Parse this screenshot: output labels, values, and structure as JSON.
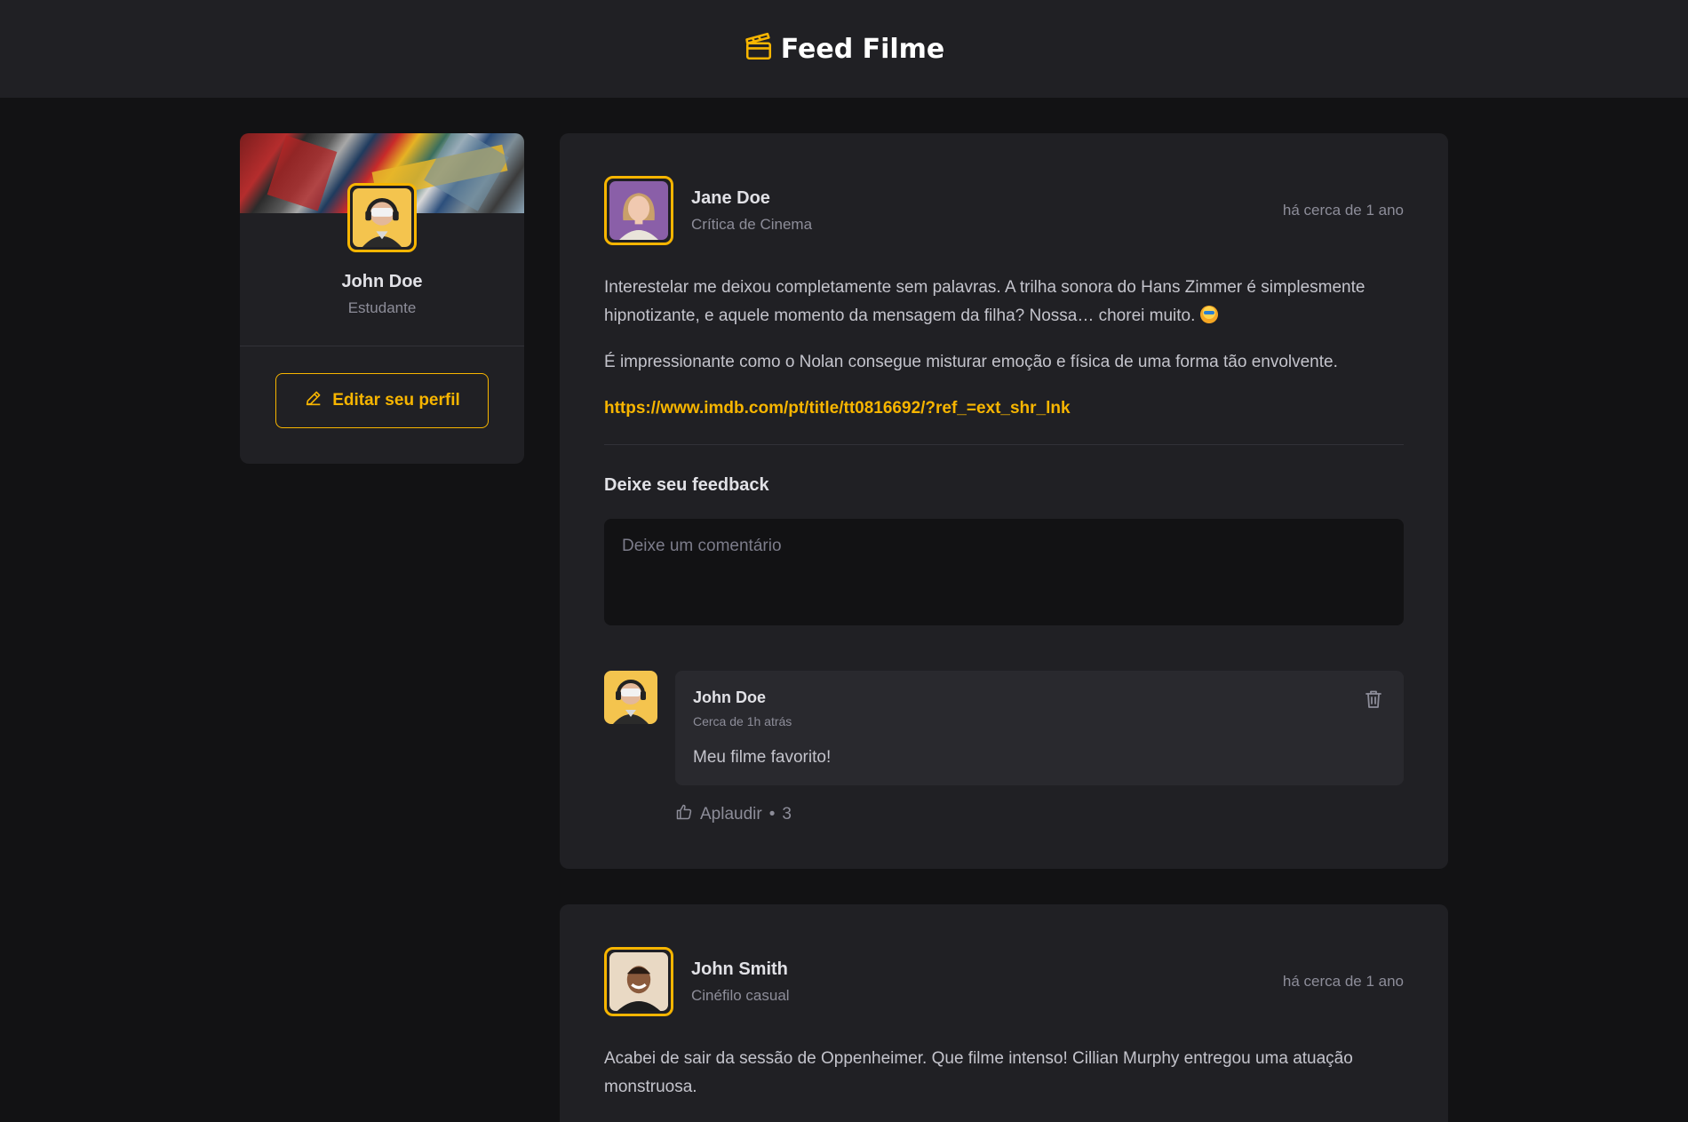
{
  "header": {
    "title": "Feed Filme",
    "logo_icon": "clapperboard-icon",
    "accent": "#f7b500"
  },
  "sidebar": {
    "profile_name": "John Doe",
    "profile_role": "Estudante",
    "edit_label": "Editar seu perfil"
  },
  "posts": [
    {
      "author": "Jane Doe",
      "role": "Crítica de Cinema",
      "time": "há cerca de 1 ano",
      "paragraphs": [
        "Interestelar me deixou completamente sem palavras. A trilha sonora do Hans Zimmer é simplesmente hipnotizante, e aquele momento da mensagem da filha? Nossa… chorei muito.",
        "É impressionante como o Nolan consegue misturar emoção e física de uma forma tão envolvente."
      ],
      "link": "https://www.imdb.com/pt/title/tt0816692/?ref_=ext_shr_lnk",
      "feedback_title": "Deixe seu feedback",
      "comment_placeholder": "Deixe um comentário",
      "comments": [
        {
          "author": "John Doe",
          "time": "Cerca de 1h atrás",
          "text": "Meu filme favorito!",
          "applaud_label": "Aplaudir",
          "applaud_separator": "•",
          "applaud_count": "3"
        }
      ]
    },
    {
      "author": "John Smith",
      "role": "Cinéfilo casual",
      "time": "há cerca de 1 ano",
      "paragraphs": [
        "Acabei de sair da sessão de Oppenheimer. Que filme intenso! Cillian Murphy entregou uma atuação monstruosa."
      ]
    }
  ]
}
